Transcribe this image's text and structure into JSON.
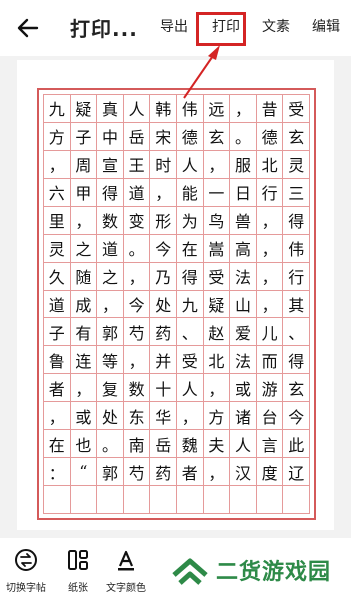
{
  "header": {
    "title": "打印...",
    "actions": {
      "export": "导出",
      "print": "打印",
      "text": "文素",
      "edit": "编辑"
    }
  },
  "toolbar": {
    "switch_paste": "切换字帖",
    "paper": "纸张",
    "text_color": "文字颜色"
  },
  "watermark": {
    "text": "二货游戏园"
  },
  "colors": {
    "highlight": "#d42424",
    "grid": "#d45a5a",
    "watermark": "#2e8a48"
  },
  "sheet": {
    "rows": [
      "九疑真人韩伟远，昔受北",
      "方子中岳宋德玄。德玄者",
      "，周宣王时人，服北灵飞",
      "六甲得道，能一日行三千",
      "里，数变形为鸟兽，得真",
      "灵之道。今在嵩高，伟远",
      "久随之，乃得受法，行之",
      "道成，今处九疑山，其女",
      "子有郭芍药、赵爱儿、王",
      "鲁连等，并受北法而得道",
      "者，复数十人，或游玄洲",
      "，或处东华，方诸台今见",
      "在也。南岳魏夫人言此云",
      "：“郭芍药者，汉度辽将"
    ]
  }
}
